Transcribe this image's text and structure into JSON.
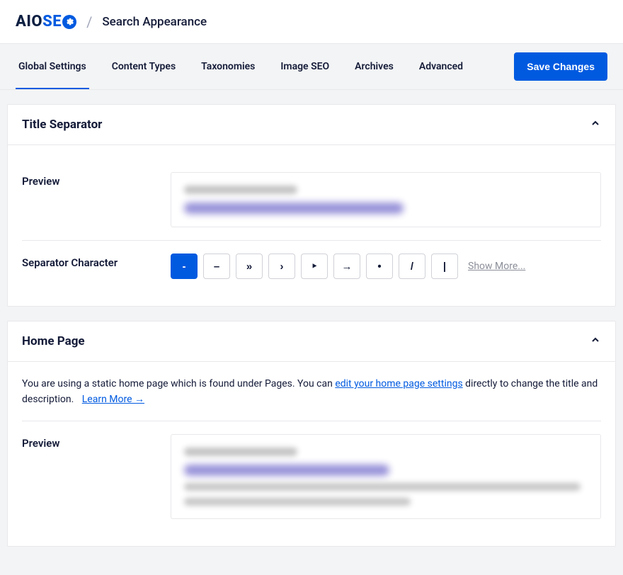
{
  "header": {
    "logo_prefix": "AIO",
    "logo_se": "SE",
    "page_title": "Search Appearance"
  },
  "tabs": [
    {
      "label": "Global Settings",
      "active": true
    },
    {
      "label": "Content Types",
      "active": false
    },
    {
      "label": "Taxonomies",
      "active": false
    },
    {
      "label": "Image SEO",
      "active": false
    },
    {
      "label": "Archives",
      "active": false
    },
    {
      "label": "Advanced",
      "active": false
    }
  ],
  "save_button": "Save Changes",
  "card1": {
    "title": "Title Separator",
    "preview_label": "Preview",
    "separator_label": "Separator Character",
    "separators": [
      "-",
      "–",
      "»",
      "›",
      "‣",
      "→",
      "•",
      "/",
      "|"
    ],
    "show_more": "Show More..."
  },
  "card2": {
    "title": "Home Page",
    "info_prefix": "You are using a static home page which is found under Pages. You can ",
    "info_link": "edit your home page settings",
    "info_suffix": " directly to change the title and description.",
    "learn_more": "Learn More →",
    "preview_label": "Preview"
  }
}
